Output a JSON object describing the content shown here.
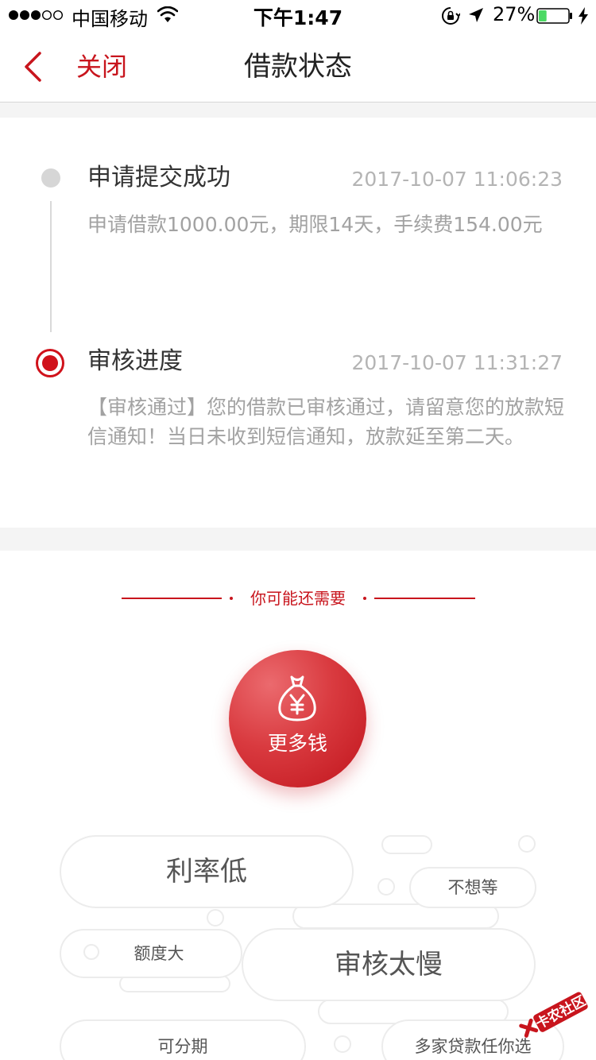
{
  "status_bar": {
    "carrier": "中国移动",
    "time": "下午1:47",
    "battery": "27%",
    "battery_level": 0.27
  },
  "nav": {
    "back_icon": "chevron-left-icon",
    "close_label": "关闭",
    "title": "借款状态"
  },
  "timeline": [
    {
      "title": "申请提交成功",
      "time": "2017-10-07 11:06:23",
      "desc": "申请借款1000.00元，期限14天，手续费154.00元"
    },
    {
      "title": "审核进度",
      "time": "2017-10-07 11:31:27",
      "desc": "【审核通过】您的借款已审核通过，请留意您的放款短信通知！当日未收到短信通知，放款延至第二天。"
    }
  ],
  "recommend": {
    "heading": "你可能还需要",
    "button_label": "更多钱",
    "button_icon": "money-bag-yuan-icon",
    "tags": [
      "利率低",
      "不想等",
      "额度大",
      "审核太慢",
      "可分期",
      "多家贷款任你选"
    ]
  },
  "watermark": {
    "text": "卡农社区"
  },
  "colors": {
    "accent": "#c8151d",
    "muted_text": "#a2a2a2",
    "timestamp": "#b4b4b4"
  }
}
